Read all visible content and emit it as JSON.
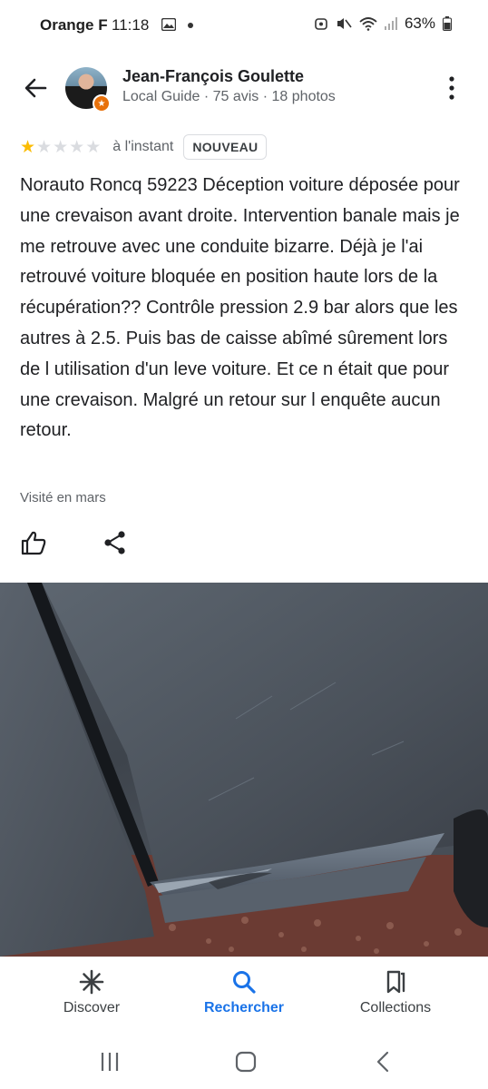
{
  "status_bar": {
    "carrier": "Orange F",
    "time": "11:18",
    "battery": "63%"
  },
  "review": {
    "author": {
      "name": "Jean-François Goulette",
      "meta": "Local Guide · 75 avis · 18 photos"
    },
    "rating": 1,
    "rating_max": 5,
    "time_ago": "à l'instant",
    "badge": "NOUVEAU",
    "text": "Norauto Roncq 59223 Déception voiture déposée pour une crevaison avant droite. Intervention banale mais je me retrouve avec une conduite bizarre. Déjà je l'ai retrouvé voiture bloquée en position haute lors de la récupération?? Contrôle pression 2.9 bar alors que les autres à 2.5. Puis bas de caisse abîmé sûrement lors de l utilisation d'un leve voiture. Et ce n était que pour une crevaison. Malgré un retour sur l enquête aucun retour.",
    "visited": "Visité en mars"
  },
  "bottom_nav": {
    "items": [
      {
        "label": "Discover",
        "icon": "discover-icon"
      },
      {
        "label": "Rechercher",
        "icon": "search-icon",
        "active": true
      },
      {
        "label": "Collections",
        "icon": "collections-icon"
      }
    ]
  },
  "colors": {
    "accent": "#1a73e8",
    "star": "#fbbc04",
    "badge": "#e8710a"
  }
}
